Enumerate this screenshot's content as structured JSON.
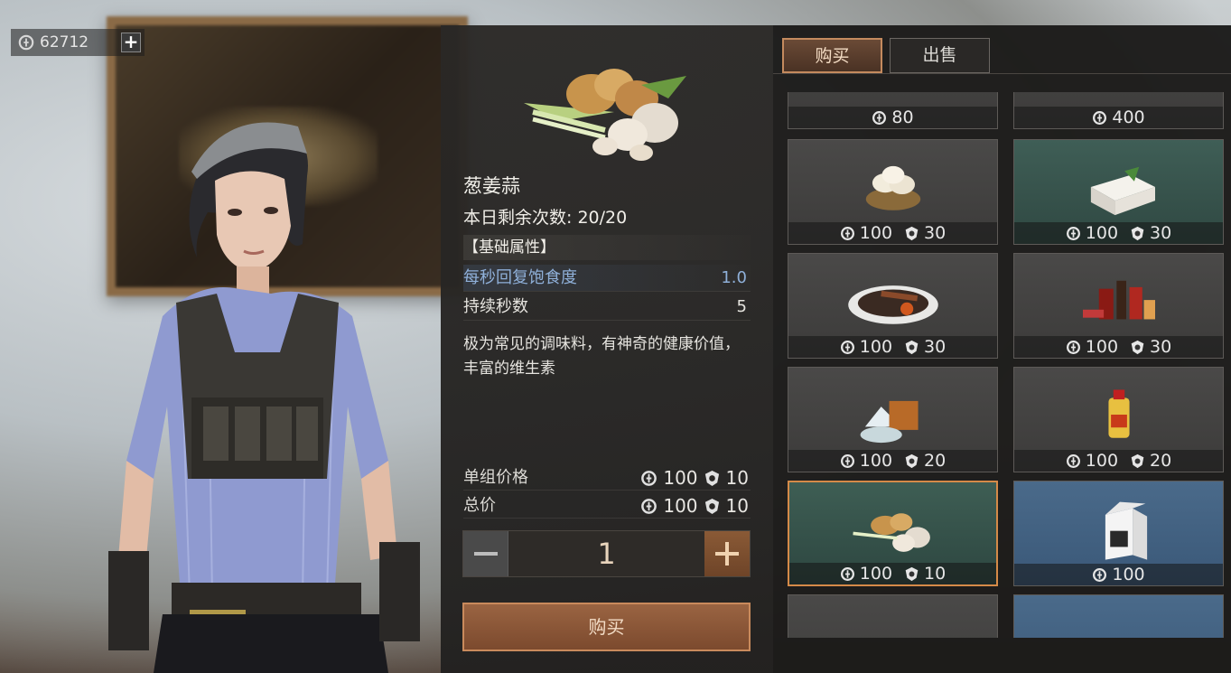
{
  "currency": {
    "amount": "62712",
    "add_label": "+"
  },
  "item": {
    "name": "葱姜蒜",
    "remaining": "本日剩余次数: 20/20",
    "attr_heading": "【基础属性】",
    "attributes": [
      {
        "label": "每秒回复饱食度",
        "value": "1.0"
      },
      {
        "label": "持续秒数",
        "value": "5"
      }
    ],
    "description": "极为常见的调味料，有神奇的健康价值，丰富的维生素",
    "unit_price_label": "单组价格",
    "unit_price_coin": "100",
    "unit_price_token": "10",
    "total_price_label": "总价",
    "total_price_coin": "100",
    "total_price_token": "10",
    "quantity": "1",
    "buy_label": "购买"
  },
  "tabs": [
    {
      "label": "购买",
      "active": true
    },
    {
      "label": "出售",
      "active": false
    }
  ],
  "shop_items": [
    {
      "art": "partial-item",
      "coin": "80",
      "token": ""
    },
    {
      "art": "partial-item",
      "coin": "400",
      "token": ""
    },
    {
      "art": "steamed-buns",
      "coin": "100",
      "token": "30"
    },
    {
      "art": "tofu",
      "coin": "100",
      "token": "30"
    },
    {
      "art": "spices-plate",
      "coin": "100",
      "token": "30"
    },
    {
      "art": "sauce-bottles",
      "coin": "100",
      "token": "30"
    },
    {
      "art": "flour-sugar",
      "coin": "100",
      "token": "20"
    },
    {
      "art": "cooking-oil",
      "coin": "100",
      "token": "20"
    },
    {
      "art": "ginger-garlic",
      "coin": "100",
      "token": "10"
    },
    {
      "art": "milk-carton",
      "coin": "100",
      "token": ""
    },
    {
      "art": "ice-cubes",
      "coin": "",
      "token": ""
    },
    {
      "art": "honeycomb",
      "coin": "",
      "token": ""
    }
  ],
  "colors": {
    "accent": "#c98a5c",
    "selected_border": "#d58a48",
    "stat_blue": "#8fb0d9",
    "teal_cell": "#3f5e56",
    "blue_cell": "#4a6a8a"
  }
}
